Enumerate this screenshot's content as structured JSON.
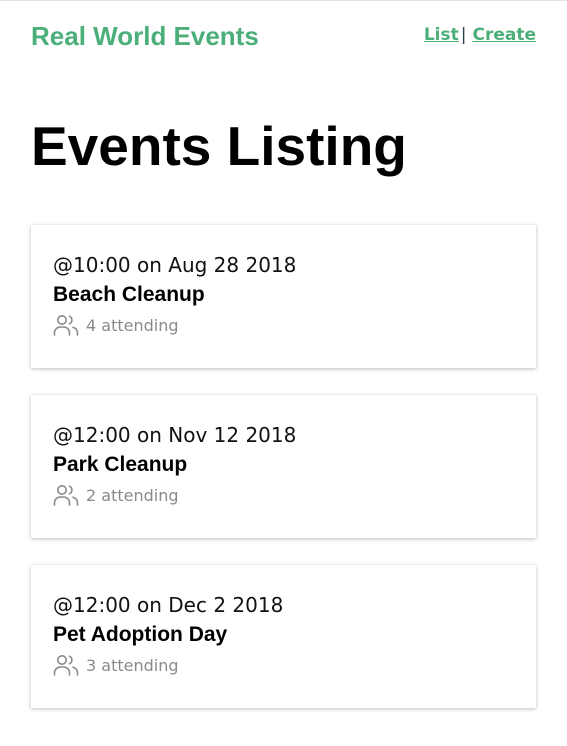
{
  "header": {
    "brand": "Real World Events",
    "nav": [
      {
        "label": "List"
      },
      {
        "label": "Create"
      }
    ],
    "separator": "|",
    "colors": {
      "accent": "#4caf7a"
    }
  },
  "main": {
    "title": "Events Listing",
    "events": [
      {
        "time": "@10:00 on Aug 28 2018",
        "title": "Beach Cleanup",
        "attending": "4 attending",
        "icon": "users-icon"
      },
      {
        "time": "@12:00 on Nov 12 2018",
        "title": "Park Cleanup",
        "attending": "2 attending",
        "icon": "users-icon"
      },
      {
        "time": "@12:00 on Dec 2 2018",
        "title": "Pet Adoption Day",
        "attending": "3 attending",
        "icon": "users-icon"
      }
    ]
  }
}
